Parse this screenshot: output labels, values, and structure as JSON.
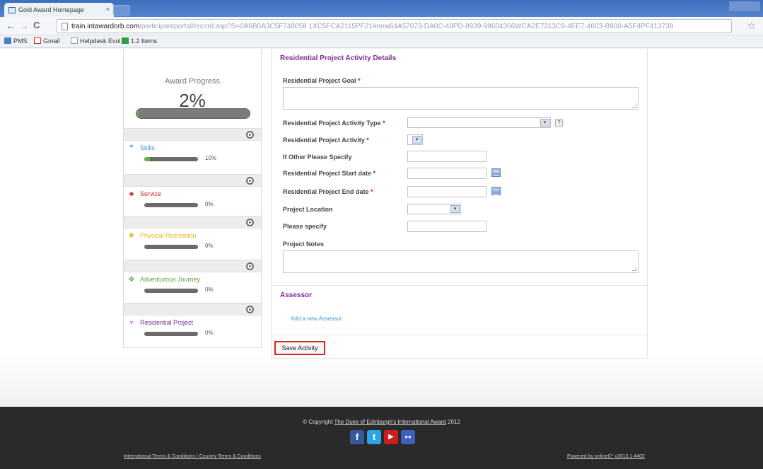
{
  "browser": {
    "tab_title": "Gold Award Homepage",
    "tab_close": "×",
    "back": "←",
    "forward": "→",
    "reload": "C",
    "url_host": "train.intawardorb.com",
    "url_rest": "/participantportal/record.asp?S=0A6B0A3C5F748058 1XC5FCA2115PF21#new64A57073-DA0C-48PD-8939-99604366WCA2E7313C9-4EE7-4603-B900-A5F4PF413738",
    "star": "☆"
  },
  "bookmarks": [
    {
      "label": "PMS",
      "icon": "folder-icon",
      "color": "#4a7fc9"
    },
    {
      "label": "Gmail",
      "icon": "gmail-icon",
      "color": "#d93025"
    },
    {
      "label": "Helpdesk Evol",
      "icon": "page-icon",
      "color": "#ffffff"
    },
    {
      "label": "1.2 Items",
      "icon": "sheet-icon",
      "color": "#2e9e44"
    }
  ],
  "sidebar": {
    "progress_title": "Award Progress",
    "progress_value": "2%",
    "progress_fraction": 0.02,
    "sections": [
      {
        "label": "Skills",
        "pct": "10%",
        "fraction": 0.1,
        "icon": "speech-bubble-icon",
        "color": "#3b9bd8",
        "glyph": "❝"
      },
      {
        "label": "Service",
        "pct": "0%",
        "fraction": 0,
        "icon": "hands-icon",
        "color": "#d0232a",
        "glyph": "♣"
      },
      {
        "label": "Physical Recreation",
        "pct": "0%",
        "fraction": 0,
        "icon": "runner-icon",
        "color": "#e8b820",
        "glyph": "✺"
      },
      {
        "label": "Adventurous Journey",
        "pct": "0%",
        "fraction": 0,
        "icon": "compass-icon",
        "color": "#5aa53a",
        "glyph": "✥"
      },
      {
        "label": "Residential Project",
        "pct": "0%",
        "fraction": 0,
        "icon": "trophy-icon",
        "color": "#7b2d8e",
        "glyph": "♆"
      }
    ]
  },
  "form": {
    "heading": "Residential Project Activity Details",
    "goal_label": "Residential Project Goal",
    "activity_type_label": "Residential Project Activity Type",
    "activity_label": "Residential Project Activity",
    "other_label": "If Other Please Specify",
    "start_label": "Residential Project Start date",
    "end_label": "Residential Project End date",
    "location_label": "Project Location",
    "please_specify_label": "Please specify",
    "notes_label": "Project Notes",
    "required_mark": "*",
    "help_mark": "?",
    "dropdown_arrow": "▾"
  },
  "assessor": {
    "title": "Assessor",
    "add_link": "Add a new Assessor"
  },
  "save_button": "Save Activity",
  "footer": {
    "copyright_prefix": "© Copyright ",
    "copyright_link": "The Duke of Edinburgh's International Award",
    "copyright_year": " 2012",
    "links": "International Terms & Conditions  |  Country Terms & Conditions",
    "powered": "Powered by onlineC* v2013.1.4402",
    "social": [
      {
        "icon": "facebook-icon",
        "glyph": "f",
        "color": "#3b5998"
      },
      {
        "icon": "twitter-icon",
        "glyph": "t",
        "color": "#2aa4e6"
      },
      {
        "icon": "youtube-icon",
        "glyph": "▶",
        "color": "#cc2020"
      },
      {
        "icon": "flickr-icon",
        "glyph": "●●",
        "color": "#3a5fbf"
      }
    ]
  }
}
